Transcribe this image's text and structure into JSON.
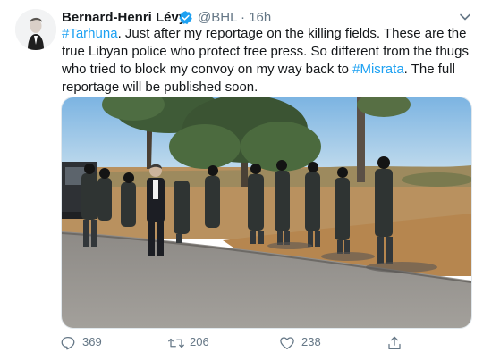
{
  "tweet": {
    "author_name": "Bernard-Henri Lévy",
    "handle": "@BHL",
    "separator": "·",
    "time": "16h",
    "text": {
      "tag1": "#Tarhuna",
      "part1": ". Just after my reportage on the killing fields. These are the true Libyan police who protect free press. So different from the thugs who tried to block my convoy on my way back to ",
      "tag2": "#Misrata",
      "part2": ". The full reportage will be published soon."
    },
    "actions": {
      "reply_count": "369",
      "retweet_count": "206",
      "like_count": "238"
    }
  },
  "icons": {
    "verified": "verified-badge-icon",
    "menu": "chevron-down-icon",
    "reply": "reply-icon",
    "retweet": "retweet-icon",
    "like": "heart-icon",
    "share": "share-icon"
  },
  "colors": {
    "accent": "#1da1f2",
    "text": "#14171a",
    "muted": "#657786"
  }
}
